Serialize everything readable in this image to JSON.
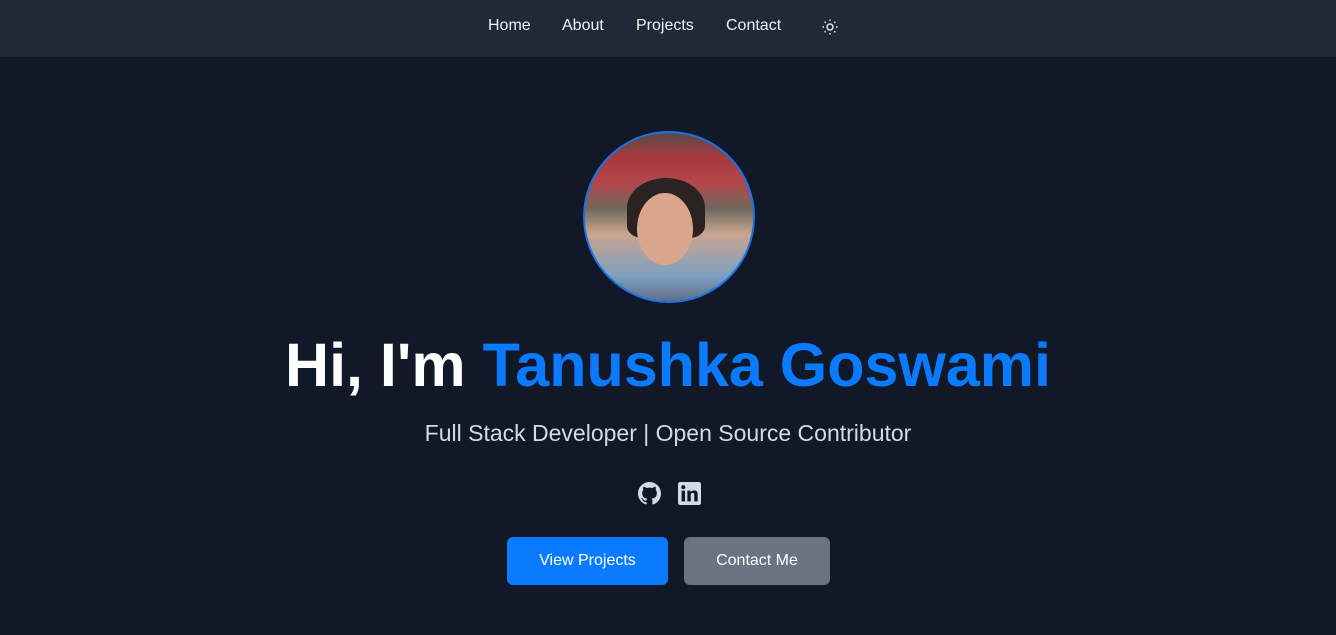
{
  "nav": {
    "items": [
      "Home",
      "About",
      "Projects",
      "Contact"
    ],
    "theme_toggle_icon": "sun-icon"
  },
  "hero": {
    "greeting": "Hi, I'm ",
    "name": "Tanushka Goswami",
    "tagline": "Full Stack Developer | Open Source Contributor"
  },
  "social": [
    "github-icon",
    "linkedin-icon"
  ],
  "buttons": {
    "primary": "View Projects",
    "secondary": "Contact Me"
  },
  "colors": {
    "accent": "#0a7bff",
    "secondary_button": "#6b7280",
    "background": "#111827",
    "nav": "#1f2937"
  }
}
